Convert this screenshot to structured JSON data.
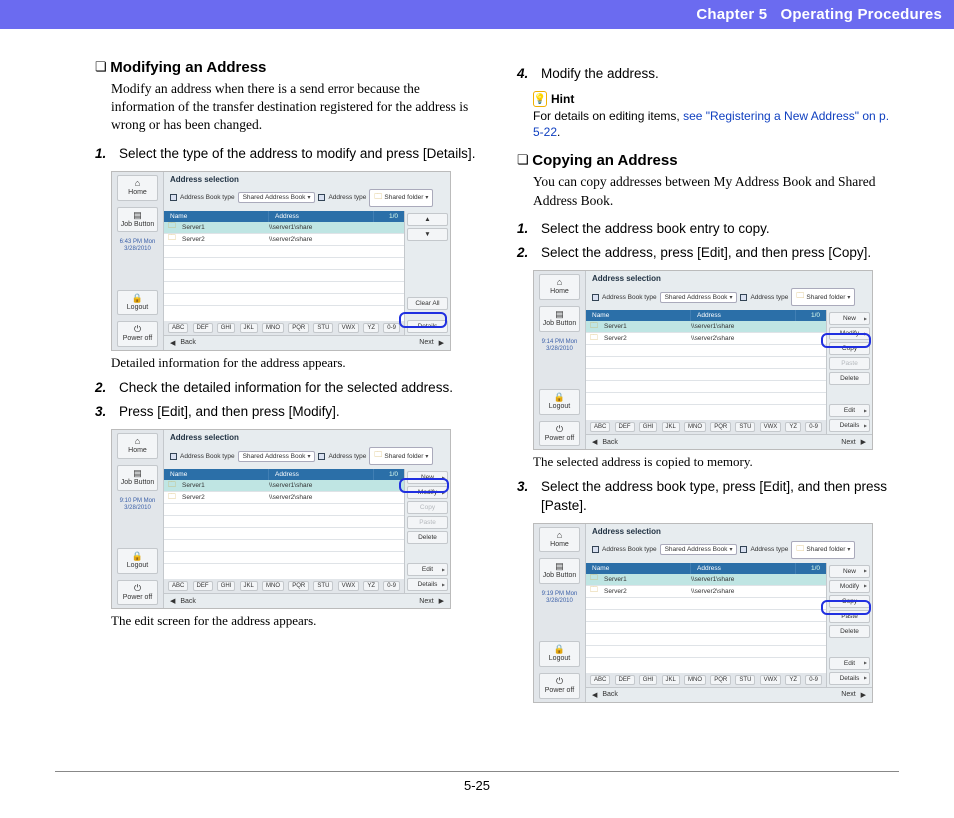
{
  "header": {
    "chapter": "Chapter 5",
    "title": "Operating Procedures"
  },
  "footer": {
    "page": "5-25"
  },
  "left": {
    "section1": {
      "title": "Modifying an Address",
      "body": "Modify an address when there is a send error because the information of the transfer destination registered for the address is wrong or has been changed.",
      "step1": "Select the type of the address to modify and press [Details].",
      "cap1": "Detailed information for the address appears.",
      "step2": "Check the detailed information for the selected address.",
      "step3": "Press [Edit], and then press [Modify].",
      "cap3": "The edit screen for the address appears."
    }
  },
  "right": {
    "step4": "Modify the address.",
    "hint_label": "Hint",
    "hint_text_a": "For details on editing items, ",
    "hint_link": "see \"Registering a New Address\" on p. 5-22",
    "section2": {
      "title": "Copying an Address",
      "body": "You can copy addresses between My Address Book and Shared Address Book.",
      "step1": "Select the address book entry to copy.",
      "step2": "Select the address, press [Edit], and then press [Copy].",
      "cap2": "The selected address is copied to memory.",
      "step3": "Select the address book type, press [Edit], and then press [Paste]."
    }
  },
  "shot": {
    "title": "Address selection",
    "abt_label": "Address Book type",
    "abt_value": "Shared Address Book",
    "at_label": "Address type",
    "at_value": "Shared folder",
    "col_name": "Name",
    "col_addr": "Address",
    "page_ind": "1/0",
    "r1_name": "Server1",
    "r1_addr": "\\\\server1\\share",
    "r2_name": "Server2",
    "r2_addr": "\\\\server2\\share",
    "side": {
      "home": "Home",
      "job": "Job Button",
      "logout": "Logout",
      "power": "Power off",
      "time1": "6:43 PM  Mon 3/28/2010",
      "time2": "9:10 PM  Mon 3/28/2010",
      "time3": "9:14 PM  Mon 3/28/2010",
      "time4": "9:19 PM  Mon 3/28/2010"
    },
    "nav_back": "Back",
    "nav_next": "Next",
    "abc": [
      "ABC",
      "DEF",
      "GHI",
      "JKL",
      "MNO",
      "PQR",
      "STU",
      "VWX",
      "YZ",
      "0-9"
    ],
    "btns": {
      "clear": "Clear All",
      "details": "Details",
      "new": "New",
      "modify": "Modify",
      "copy": "Copy",
      "paste": "Paste",
      "delete": "Delete",
      "edit": "Edit",
      "up": "▲",
      "down": "▼"
    }
  }
}
